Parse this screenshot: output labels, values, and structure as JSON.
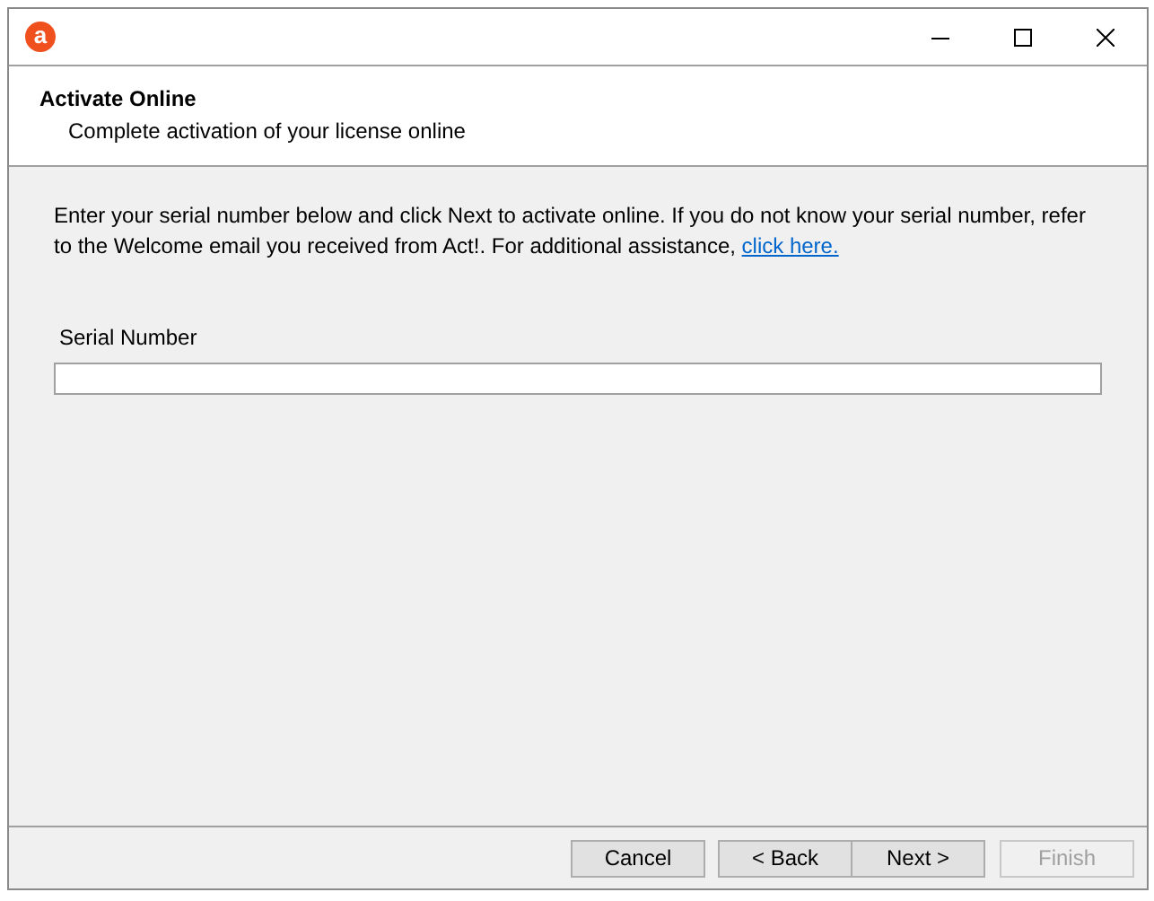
{
  "window": {
    "logo": "a",
    "controls": [
      {
        "kind": "minimize"
      },
      {
        "kind": "maximize"
      },
      {
        "kind": "close"
      }
    ]
  },
  "header": {
    "title": "Activate Online",
    "subtitle": "Complete activation of your license online"
  },
  "instructions": {
    "text": "Enter your serial number below and click Next to activate online. If you do not know your serial number, refer to the Welcome email you received from Act!. For additional assistance, ",
    "link": "click here."
  },
  "serial_field": {
    "label": "Serial Number"
  },
  "buttons": [
    {
      "label": "Cancel",
      "disabled": false
    },
    {
      "label": "< Back",
      "disabled": false
    },
    {
      "label": "Next >",
      "disabled": false
    },
    {
      "label": "Finish",
      "disabled": true
    }
  ]
}
